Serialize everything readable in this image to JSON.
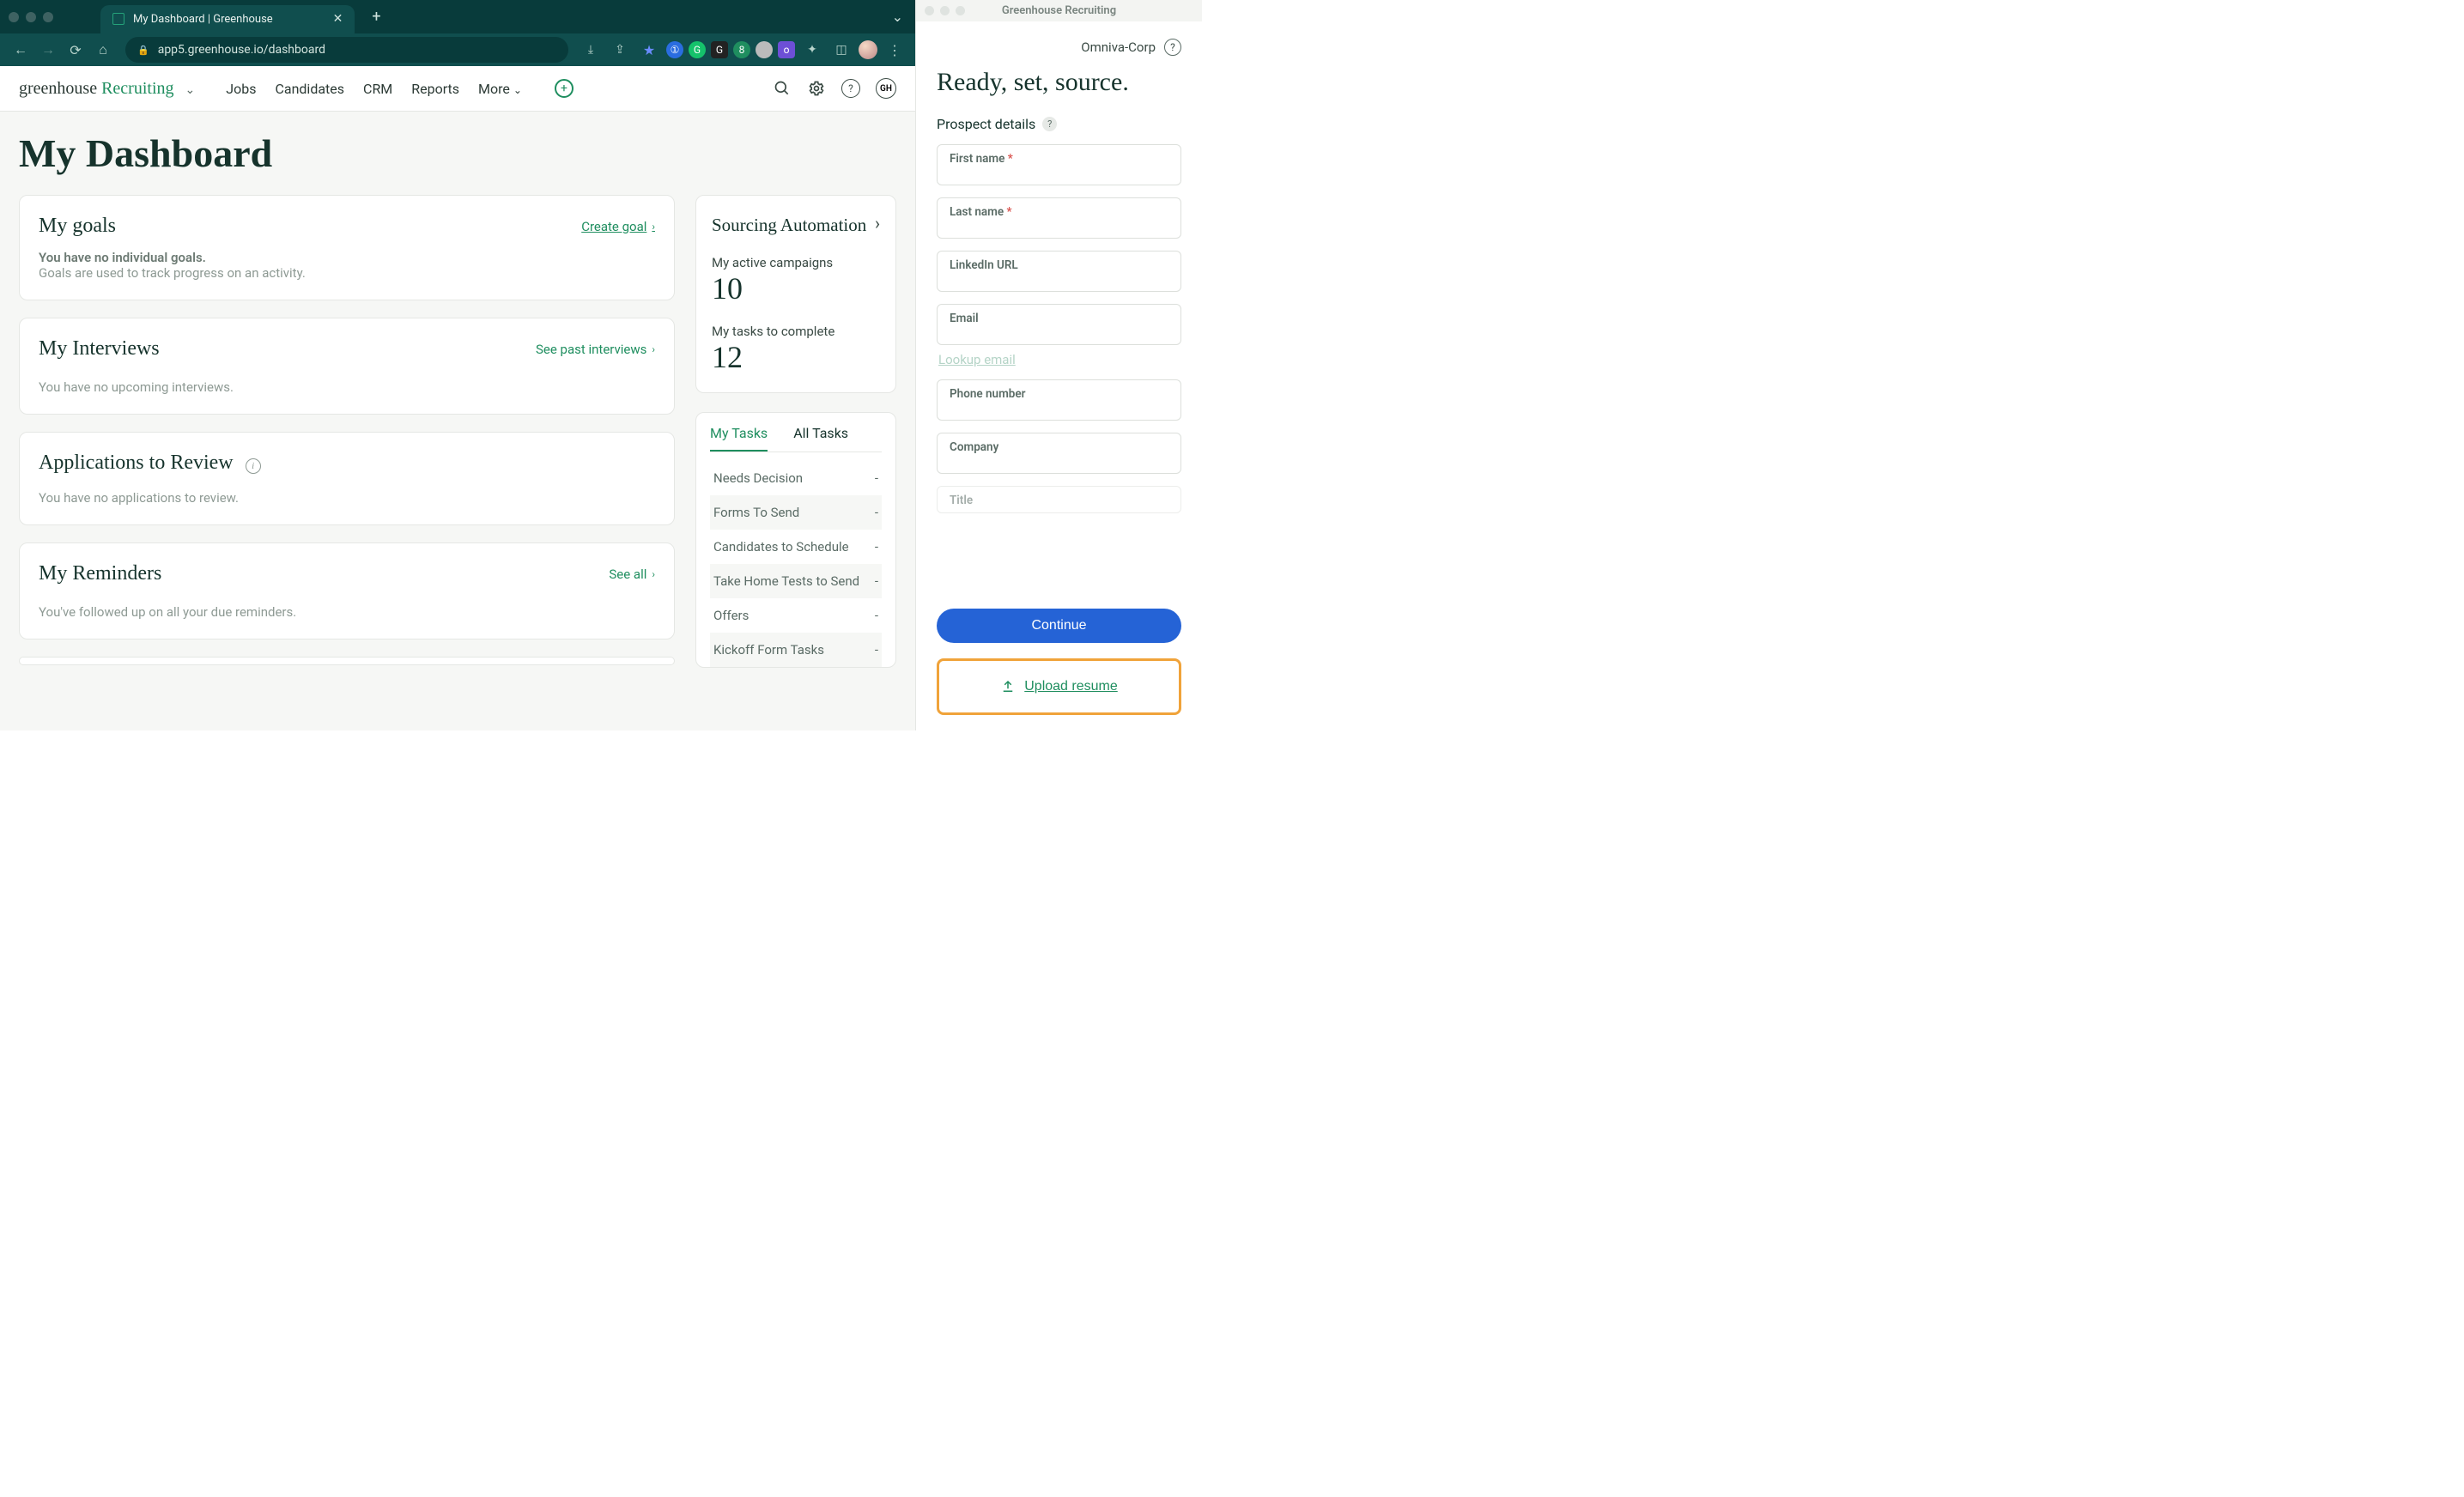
{
  "browser": {
    "tab_title": "My Dashboard | Greenhouse",
    "url": "app5.greenhouse.io/dashboard"
  },
  "header": {
    "logo_left": "greenhouse ",
    "logo_right": "Recruiting",
    "nav": {
      "jobs": "Jobs",
      "candidates": "Candidates",
      "crm": "CRM",
      "reports": "Reports",
      "more": "More"
    },
    "avatar_initials": "GH"
  },
  "page": {
    "title": "My Dashboard",
    "goals": {
      "title": "My goals",
      "link": "Create goal",
      "empty_strong": "You have no individual goals.",
      "empty_sub": "Goals are used to track progress on an activity."
    },
    "interviews": {
      "title": "My Interviews",
      "link": "See past interviews",
      "empty": "You have no upcoming interviews."
    },
    "applications": {
      "title": "Applications to Review",
      "empty": "You have no applications to review."
    },
    "reminders": {
      "title": "My Reminders",
      "link": "See all",
      "empty": "You've followed up on all your due reminders."
    },
    "sourcing": {
      "title": "Sourcing Automation",
      "active_label": "My active campaigns",
      "active_value": "10",
      "tasks_label": "My tasks to complete",
      "tasks_value": "12"
    },
    "tasks": {
      "tab_my": "My Tasks",
      "tab_all": "All Tasks",
      "rows": [
        {
          "label": "Needs Decision",
          "value": "-"
        },
        {
          "label": "Forms To Send",
          "value": "-"
        },
        {
          "label": "Candidates to Schedule",
          "value": "-"
        },
        {
          "label": "Take Home Tests to Send",
          "value": "-"
        },
        {
          "label": "Offers",
          "value": "-"
        },
        {
          "label": "Kickoff Form Tasks",
          "value": "-"
        }
      ]
    }
  },
  "ext": {
    "window_title": "Greenhouse Recruiting",
    "org": "Omniva-Corp",
    "heading": "Ready, set, source.",
    "section": "Prospect details",
    "fields": {
      "first_name": "First name",
      "last_name": "Last name",
      "linkedin": "LinkedIn URL",
      "email": "Email",
      "lookup": "Lookup email",
      "phone": "Phone number",
      "company": "Company",
      "title": "Title"
    },
    "continue": "Continue",
    "upload": "Upload resume"
  }
}
